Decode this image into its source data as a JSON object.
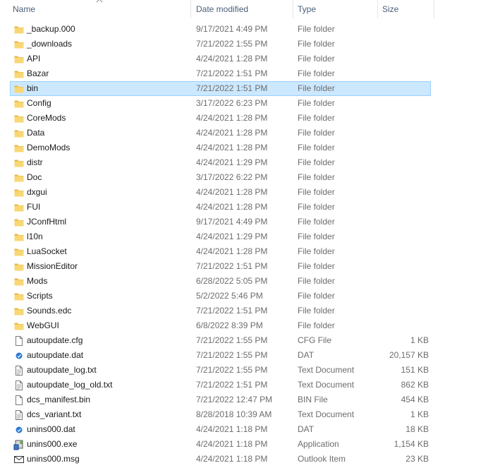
{
  "columns": {
    "name": "Name",
    "date": "Date modified",
    "type": "Type",
    "size": "Size"
  },
  "sort": {
    "column": "name",
    "direction": "ascending"
  },
  "colors": {
    "selection_bg": "#cce8ff",
    "selection_border": "#99d1ff",
    "folder": "#f8d775",
    "header_text": "#4c607a"
  },
  "files": [
    {
      "name": "_backup.000",
      "date": "9/17/2021 4:49 PM",
      "type": "File folder",
      "size": "",
      "icon": "folder-icon"
    },
    {
      "name": "_downloads",
      "date": "7/21/2022 1:55 PM",
      "type": "File folder",
      "size": "",
      "icon": "folder-icon"
    },
    {
      "name": "API",
      "date": "4/24/2021 1:28 PM",
      "type": "File folder",
      "size": "",
      "icon": "folder-icon"
    },
    {
      "name": "Bazar",
      "date": "7/21/2022 1:51 PM",
      "type": "File folder",
      "size": "",
      "icon": "folder-icon"
    },
    {
      "name": "bin",
      "date": "7/21/2022 1:51 PM",
      "type": "File folder",
      "size": "",
      "icon": "folder-icon",
      "selected": true
    },
    {
      "name": "Config",
      "date": "3/17/2022 6:23 PM",
      "type": "File folder",
      "size": "",
      "icon": "folder-icon"
    },
    {
      "name": "CoreMods",
      "date": "4/24/2021 1:28 PM",
      "type": "File folder",
      "size": "",
      "icon": "folder-icon"
    },
    {
      "name": "Data",
      "date": "4/24/2021 1:28 PM",
      "type": "File folder",
      "size": "",
      "icon": "folder-icon"
    },
    {
      "name": "DemoMods",
      "date": "4/24/2021 1:28 PM",
      "type": "File folder",
      "size": "",
      "icon": "folder-icon"
    },
    {
      "name": "distr",
      "date": "4/24/2021 1:29 PM",
      "type": "File folder",
      "size": "",
      "icon": "folder-icon"
    },
    {
      "name": "Doc",
      "date": "3/17/2022 6:22 PM",
      "type": "File folder",
      "size": "",
      "icon": "folder-icon"
    },
    {
      "name": "dxgui",
      "date": "4/24/2021 1:28 PM",
      "type": "File folder",
      "size": "",
      "icon": "folder-icon"
    },
    {
      "name": "FUI",
      "date": "4/24/2021 1:28 PM",
      "type": "File folder",
      "size": "",
      "icon": "folder-icon"
    },
    {
      "name": "JConfHtml",
      "date": "9/17/2021 4:49 PM",
      "type": "File folder",
      "size": "",
      "icon": "folder-icon"
    },
    {
      "name": "l10n",
      "date": "4/24/2021 1:29 PM",
      "type": "File folder",
      "size": "",
      "icon": "folder-icon"
    },
    {
      "name": "LuaSocket",
      "date": "4/24/2021 1:28 PM",
      "type": "File folder",
      "size": "",
      "icon": "folder-icon"
    },
    {
      "name": "MissionEditor",
      "date": "7/21/2022 1:51 PM",
      "type": "File folder",
      "size": "",
      "icon": "folder-icon"
    },
    {
      "name": "Mods",
      "date": "6/28/2022 5:05 PM",
      "type": "File folder",
      "size": "",
      "icon": "folder-icon"
    },
    {
      "name": "Scripts",
      "date": "5/2/2022 5:46 PM",
      "type": "File folder",
      "size": "",
      "icon": "folder-icon"
    },
    {
      "name": "Sounds.edc",
      "date": "7/21/2022 1:51 PM",
      "type": "File folder",
      "size": "",
      "icon": "folder-icon"
    },
    {
      "name": "WebGUI",
      "date": "6/8/2022 8:39 PM",
      "type": "File folder",
      "size": "",
      "icon": "folder-icon"
    },
    {
      "name": "autoupdate.cfg",
      "date": "7/21/2022 1:55 PM",
      "type": "CFG File",
      "size": "1 KB",
      "icon": "file-icon"
    },
    {
      "name": "autoupdate.dat",
      "date": "7/21/2022 1:55 PM",
      "type": "DAT",
      "size": "20,157 KB",
      "icon": "dat-icon"
    },
    {
      "name": "autoupdate_log.txt",
      "date": "7/21/2022 1:55 PM",
      "type": "Text Document",
      "size": "151 KB",
      "icon": "text-file-icon"
    },
    {
      "name": "autoupdate_log_old.txt",
      "date": "7/21/2022 1:51 PM",
      "type": "Text Document",
      "size": "862 KB",
      "icon": "text-file-icon"
    },
    {
      "name": "dcs_manifest.bin",
      "date": "7/21/2022 12:47 PM",
      "type": "BIN File",
      "size": "454 KB",
      "icon": "file-icon"
    },
    {
      "name": "dcs_variant.txt",
      "date": "8/28/2018 10:39 AM",
      "type": "Text Document",
      "size": "1 KB",
      "icon": "text-file-icon"
    },
    {
      "name": "unins000.dat",
      "date": "4/24/2021 1:18 PM",
      "type": "DAT",
      "size": "18 KB",
      "icon": "dat-icon"
    },
    {
      "name": "unins000.exe",
      "date": "4/24/2021 1:18 PM",
      "type": "Application",
      "size": "1,154 KB",
      "icon": "installer-app-icon"
    },
    {
      "name": "unins000.msg",
      "date": "4/24/2021 1:18 PM",
      "type": "Outlook Item",
      "size": "23 KB",
      "icon": "mail-icon"
    }
  ]
}
